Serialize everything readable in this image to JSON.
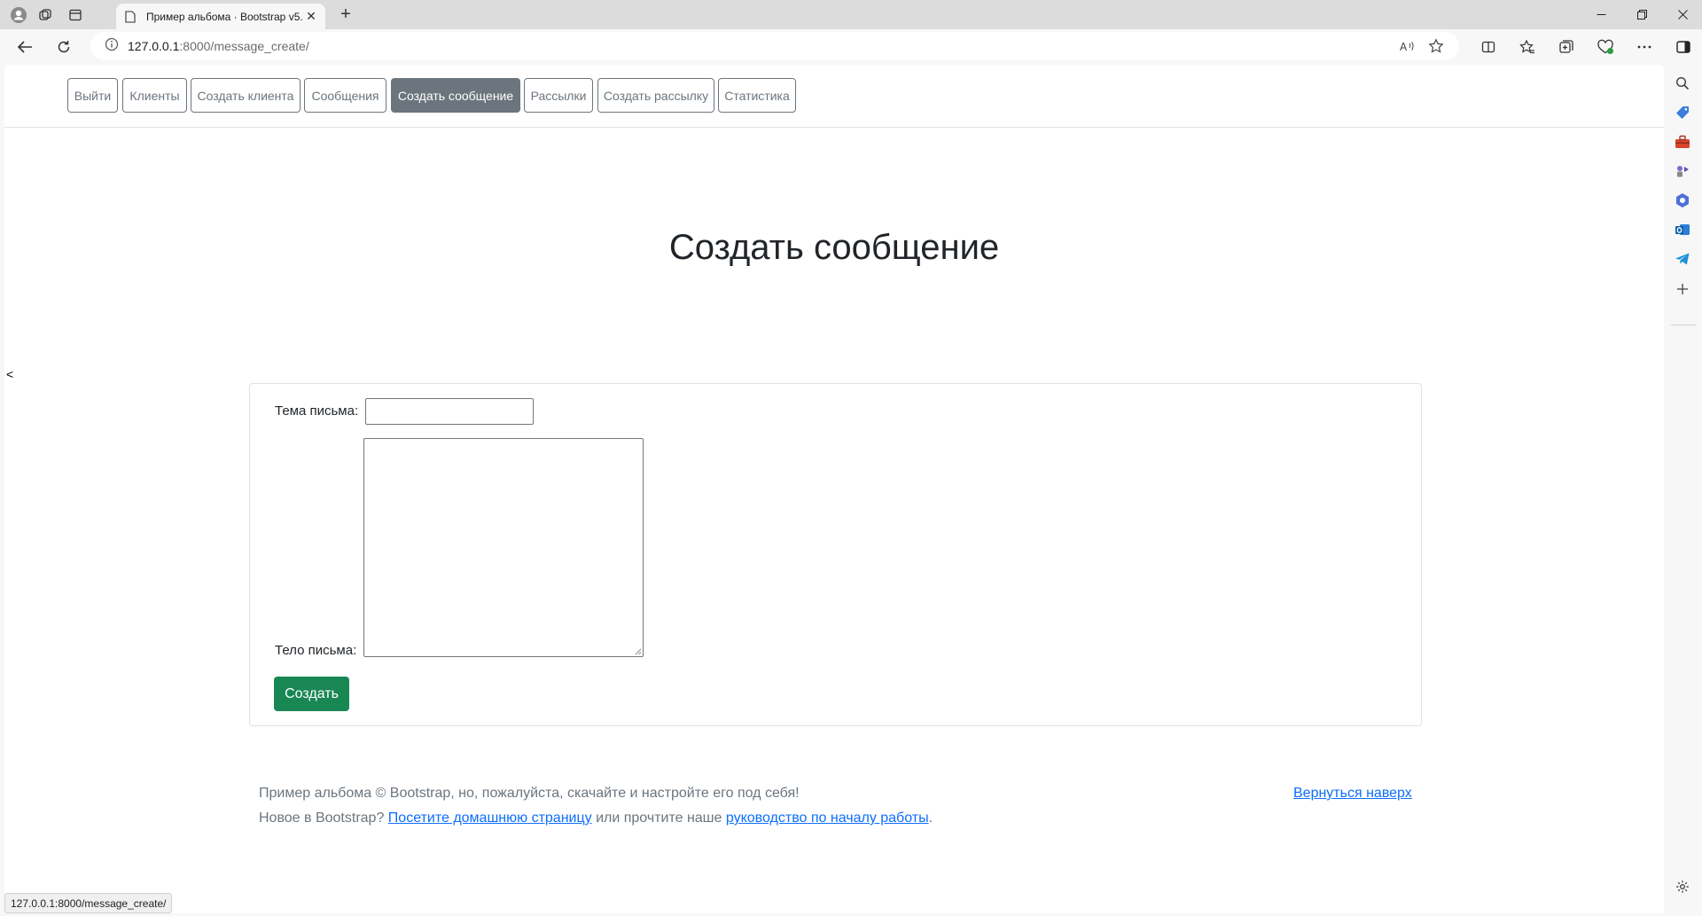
{
  "browser": {
    "tab_title": "Пример альбома · Bootstrap v5.",
    "tab_close": "✕",
    "new_tab": "+",
    "url_host": "127.0.0.1",
    "url_rest": ":8000/message_create/",
    "status_url": "127.0.0.1:8000/message_create/"
  },
  "nav": {
    "logout": "Выйти",
    "clients": "Клиенты",
    "create_client": "Создать клиента",
    "messages": "Сообщения",
    "create_message": "Создать сообщение",
    "mailings": "Рассылки",
    "create_mailing": "Создать рассылку",
    "stats": "Статистика"
  },
  "page": {
    "title": "Создать сообщение",
    "side_handle": "<"
  },
  "form": {
    "subject_label": "Тема письма:",
    "subject_value": "",
    "body_label": "Тело письма:",
    "body_value": "",
    "submit_label": "Создать"
  },
  "footer": {
    "line1": "Пример альбома © Bootstrap, но, пожалуйста, скачайте и настройте его под себя!",
    "back_to_top": "Вернуться наверх",
    "line2_prefix": "Новое в Bootstrap? ",
    "home_link": "Посетите домашнюю страницу",
    "line2_middle": " или прочтите наше ",
    "guide_link": "руководство по началу работы",
    "line2_suffix": "."
  },
  "colors": {
    "active_nav": "#6c757d",
    "submit": "#198754",
    "link": "#0d6efd"
  }
}
